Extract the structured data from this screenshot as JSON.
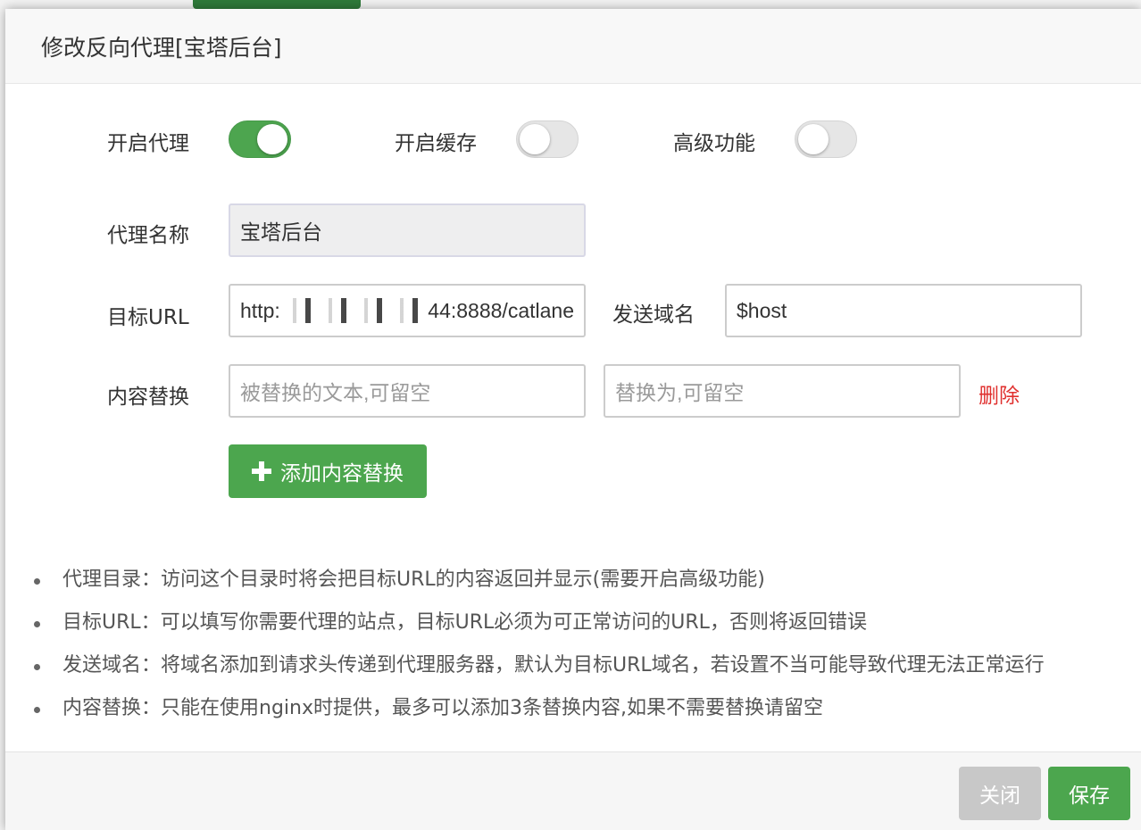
{
  "dialog": {
    "title": "修改反向代理[宝塔后台]"
  },
  "toggles": [
    {
      "label": "开启代理",
      "state": "on"
    },
    {
      "label": "开启缓存",
      "state": "off"
    },
    {
      "label": "高级功能",
      "state": "off"
    }
  ],
  "form": {
    "proxy_name_label": "代理名称",
    "proxy_name_value": "宝塔后台",
    "target_url_label": "目标URL",
    "target_url_prefix": "http:",
    "target_url_suffix": "44:8888/catlane",
    "send_domain_label": "发送域名",
    "send_domain_value": "$host",
    "content_replace_label": "内容替换",
    "replace_from_placeholder": "被替换的文本,可留空",
    "replace_to_placeholder": "替换为,可留空",
    "delete_label": "删除",
    "add_button_label": "添加内容替换"
  },
  "tips": [
    "代理目录：访问这个目录时将会把目标URL的内容返回并显示(需要开启高级功能)",
    "目标URL：可以填写你需要代理的站点，目标URL必须为可正常访问的URL，否则将返回错误",
    "发送域名：将域名添加到请求头传递到代理服务器，默认为目标URL域名，若设置不当可能导致代理无法正常运行",
    "内容替换：只能在使用nginx时提供，最多可以添加3条替换内容,如果不需要替换请留空"
  ],
  "footer": {
    "close_label": "关闭",
    "save_label": "保存"
  },
  "colors": {
    "accent_green": "#4ca64e",
    "danger_red": "#e0312f",
    "disabled_gray": "#c8c8c8"
  }
}
